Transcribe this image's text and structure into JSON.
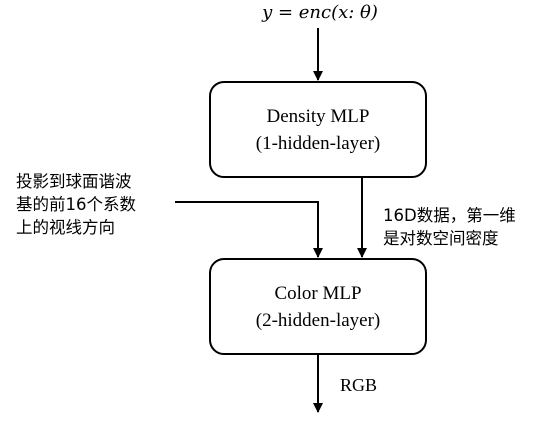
{
  "formula": "y = enc(x: θ)",
  "density_mlp": {
    "title": "Density MLP",
    "subtitle": "(1-hidden-layer)"
  },
  "color_mlp": {
    "title": "Color MLP",
    "subtitle": "(2-hidden-layer)"
  },
  "view_direction_input": {
    "lines": [
      "投影到球面谐波",
      "基的前16个系数",
      "上的视线方向"
    ]
  },
  "density_output": {
    "lines": [
      "16D数据，第一维",
      "是对数空间密度"
    ]
  },
  "output_label": "RGB"
}
